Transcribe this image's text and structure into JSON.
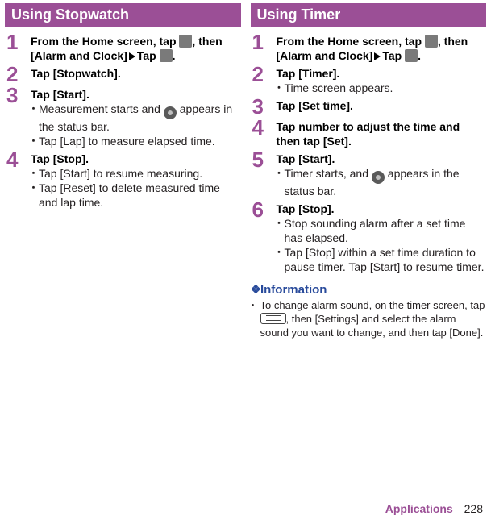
{
  "left": {
    "header": "Using Stopwatch",
    "steps": [
      {
        "num": "1",
        "title_pre": "From the Home screen, tap ",
        "title_mid": ", then [Alarm and Clock]",
        "title_post": "Tap ",
        "title_end": "."
      },
      {
        "num": "2",
        "title": "Tap [Stopwatch]."
      },
      {
        "num": "3",
        "title": "Tap [Start].",
        "bullets": [
          {
            "pre": "Measurement starts and ",
            "post": " appears in the status bar.",
            "icon": "circle"
          },
          {
            "text": "Tap [Lap] to measure elapsed time."
          }
        ]
      },
      {
        "num": "4",
        "title": "Tap [Stop].",
        "bullets": [
          {
            "text": "Tap [Start] to resume measuring."
          },
          {
            "text": "Tap [Reset] to delete measured time and lap time."
          }
        ]
      }
    ]
  },
  "right": {
    "header": "Using Timer",
    "steps": [
      {
        "num": "1",
        "title_pre": "From the Home screen, tap ",
        "title_mid": ", then [Alarm and Clock]",
        "title_post": "Tap ",
        "title_end": "."
      },
      {
        "num": "2",
        "title": "Tap [Timer].",
        "bullets": [
          {
            "text": "Time screen appears."
          }
        ]
      },
      {
        "num": "3",
        "title": "Tap [Set time]."
      },
      {
        "num": "4",
        "title": "Tap number to adjust the time and then tap [Set]."
      },
      {
        "num": "5",
        "title": "Tap [Start].",
        "bullets": [
          {
            "pre": "Timer starts, and ",
            "post": " appears in the status bar.",
            "icon": "circle"
          }
        ]
      },
      {
        "num": "6",
        "title": "Tap [Stop].",
        "bullets": [
          {
            "text": "Stop sounding alarm after a set time has elapsed."
          },
          {
            "text": "Tap [Stop] within a set time duration to pause timer. Tap [Start] to resume timer."
          }
        ]
      }
    ],
    "info_header": "Information",
    "info_pre": "To change alarm sound, on the timer screen, tap ",
    "info_post": ", then [Settings] and select the alarm sound you want to change, and then tap [Done]."
  },
  "footer": {
    "section": "Applications",
    "page": "228"
  }
}
